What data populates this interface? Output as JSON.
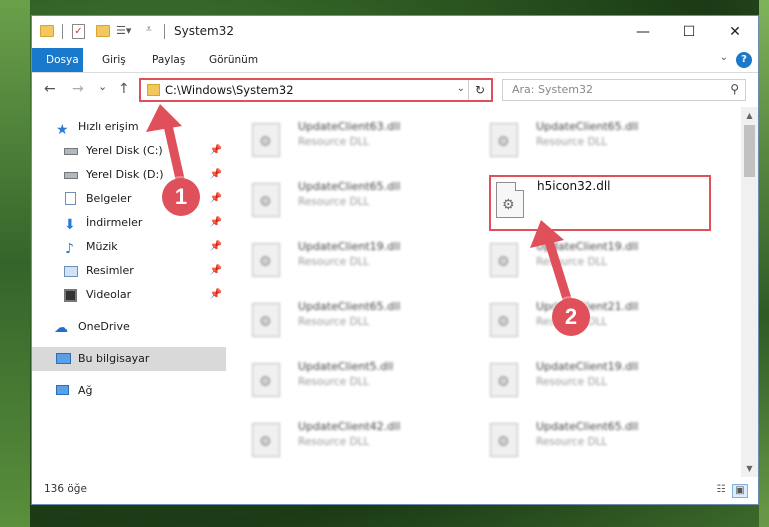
{
  "window": {
    "title": "System32",
    "controls": {
      "minimize": "—",
      "maximize": "☐",
      "close": "✕"
    }
  },
  "ribbon": {
    "tabs": [
      "Dosya",
      "Giriş",
      "Paylaş",
      "Görünüm"
    ],
    "help": "?"
  },
  "navbar": {
    "back": "←",
    "forward": "→",
    "recent": "⌄",
    "up": "↑",
    "address": "C:\\Windows\\System32",
    "refresh": "↻",
    "search_placeholder": "Ara: System32"
  },
  "sidebar": {
    "quick_access": "Hızlı erişim",
    "items": [
      {
        "label": "Yerel Disk (C:)",
        "icon": "drive-icon"
      },
      {
        "label": "Yerel Disk (D:)",
        "icon": "drive-icon"
      },
      {
        "label": "Belgeler",
        "icon": "documents-icon"
      },
      {
        "label": "İndirmeler",
        "icon": "download-icon"
      },
      {
        "label": "Müzik",
        "icon": "music-icon"
      },
      {
        "label": "Resimler",
        "icon": "pictures-icon"
      },
      {
        "label": "Videolar",
        "icon": "videos-icon"
      }
    ],
    "onedrive": "OneDrive",
    "this_pc": "Bu bilgisayar",
    "network": "Ağ"
  },
  "files": {
    "left_column": [
      {
        "name": "UpdateClient63.dll",
        "type": "Resource DLL"
      },
      {
        "name": "UpdateClient65.dll",
        "type": "Resource DLL"
      },
      {
        "name": "UpdateClient19.dll",
        "type": "Resource DLL"
      },
      {
        "name": "UpdateClient65.dll",
        "type": "Resource DLL"
      },
      {
        "name": "UpdateClient5.dll",
        "type": "Resource DLL"
      },
      {
        "name": "UpdateClient42.dll",
        "type": "Resource DLL"
      }
    ],
    "right_column": [
      {
        "name": "UpdateClient65.dll",
        "type": "Resource DLL"
      },
      {
        "name": "h5icon32.dll",
        "type": ""
      },
      {
        "name": "UpdateClient19.dll",
        "type": "Resource DLL"
      },
      {
        "name": "UpdateClient21.dll",
        "type": "Resource DLL"
      },
      {
        "name": "UpdateClient19.dll",
        "type": "Resource DLL"
      },
      {
        "name": "UpdateClient65.dll",
        "type": "Resource DLL"
      }
    ],
    "highlighted": "h5icon32.dll"
  },
  "status": {
    "count": "136 öğe"
  },
  "annotations": {
    "badge1": "1",
    "badge2": "2",
    "color": "#e0505a"
  }
}
